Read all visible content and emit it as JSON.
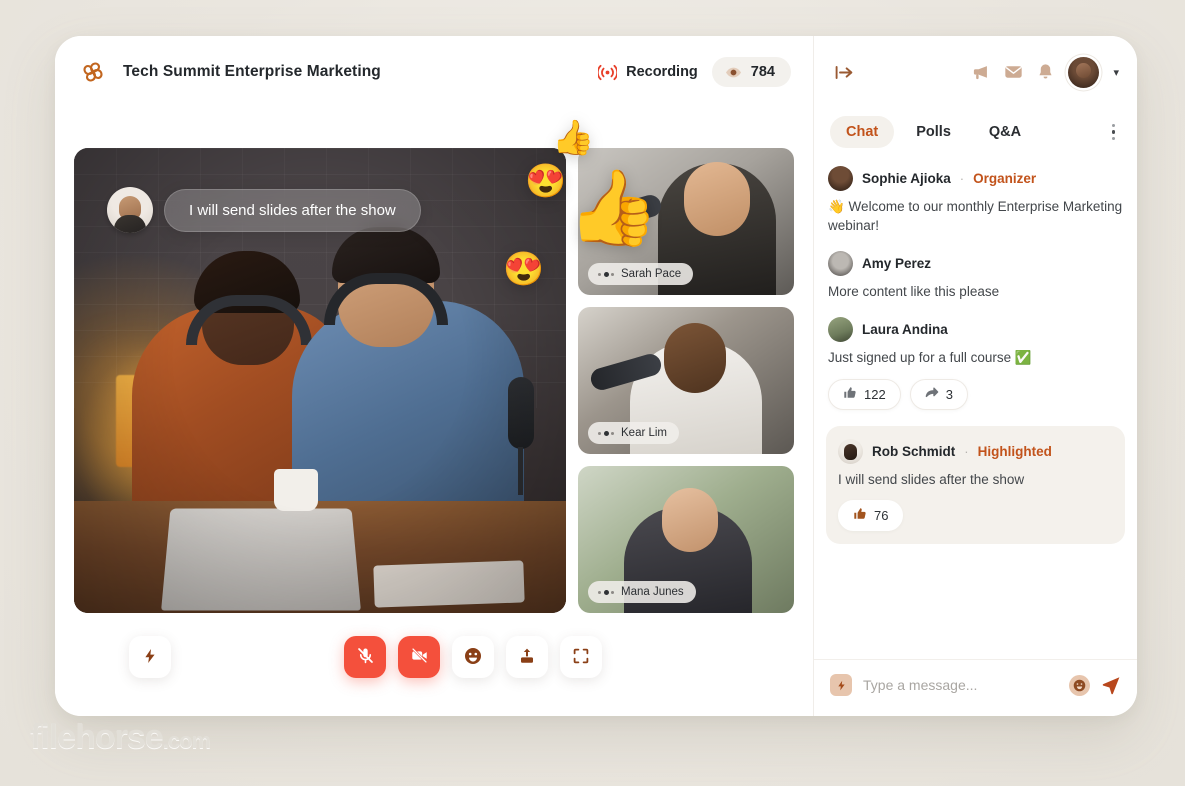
{
  "app": {
    "title": "Tech Summit Enterprise Marketing",
    "logo_icon": "flower-logo-icon",
    "accent_orange": "#c2531b",
    "accent_red": "#f4503c",
    "background": "#edeae3"
  },
  "header": {
    "recording_label": "Recording",
    "recording_icon": "broadcast-icon",
    "viewer_count": "784",
    "viewer_icon": "eye-icon",
    "collapse_icon": "collapse-panel-icon",
    "icons": [
      {
        "name": "megaphone-icon"
      },
      {
        "name": "envelope-icon"
      },
      {
        "name": "bell-icon"
      }
    ],
    "avatar_icon": "user-avatar",
    "chevron_icon": "chevron-down-icon"
  },
  "stage": {
    "overlay_message": {
      "text": "I will send slides after the show",
      "avatar": "rob-schmidt-avatar"
    },
    "reactions": [
      {
        "name": "thumbs-up-small",
        "emoji": "👍"
      },
      {
        "name": "thumbs-up-large",
        "emoji": "👍"
      },
      {
        "name": "heart-eyes-upper",
        "emoji": "😍"
      },
      {
        "name": "heart-eyes-lower",
        "emoji": "😍"
      }
    ],
    "tiles": [
      {
        "name": "Sarah Pace"
      },
      {
        "name": "Kear Lim"
      },
      {
        "name": "Mana Junes"
      }
    ]
  },
  "controls": {
    "bolt_label": "bolt-icon",
    "buttons": [
      {
        "name": "microphone-muted",
        "icon": "mic-off-icon",
        "state": "muted"
      },
      {
        "name": "camera-off",
        "icon": "camera-off-icon",
        "state": "off"
      },
      {
        "name": "reactions",
        "icon": "emoji-icon",
        "state": "default"
      },
      {
        "name": "share-screen",
        "icon": "share-upload-icon",
        "state": "default"
      },
      {
        "name": "fullscreen",
        "icon": "fullscreen-icon",
        "state": "default"
      }
    ]
  },
  "chat": {
    "tabs": [
      {
        "label": "Chat",
        "active": true
      },
      {
        "label": "Polls",
        "active": false
      },
      {
        "label": "Q&A",
        "active": false
      }
    ],
    "menu_icon": "kebab-menu-icon",
    "messages": [
      {
        "author": "Sophie Ajioka",
        "role": "Organizer",
        "separator": "·",
        "text": "👋 Welcome to our monthly Enterprise Marketing webinar!",
        "highlighted": false,
        "reactions": []
      },
      {
        "author": "Amy Perez",
        "role": "",
        "separator": "",
        "text": "More content like this please",
        "highlighted": false,
        "reactions": []
      },
      {
        "author": "Laura Andina",
        "role": "",
        "separator": "",
        "text": "Just signed up for a full course ✅",
        "highlighted": false,
        "reactions": [
          {
            "icon": "thumbs-up-icon",
            "count": "122"
          },
          {
            "icon": "share-arrow-icon",
            "count": "3"
          }
        ]
      },
      {
        "author": "Rob Schmidt",
        "role": "Highlighted",
        "separator": "·",
        "text": "I will send slides after the show",
        "highlighted": true,
        "reactions": [
          {
            "icon": "thumbs-up-icon",
            "count": "76"
          }
        ]
      }
    ],
    "composer": {
      "placeholder": "Type a message...",
      "bolt_icon": "bolt-icon",
      "emoji_icon": "smiley-icon",
      "send_icon": "send-icon",
      "value": ""
    }
  },
  "watermark": {
    "text": "filehorse",
    "suffix": ".com"
  }
}
